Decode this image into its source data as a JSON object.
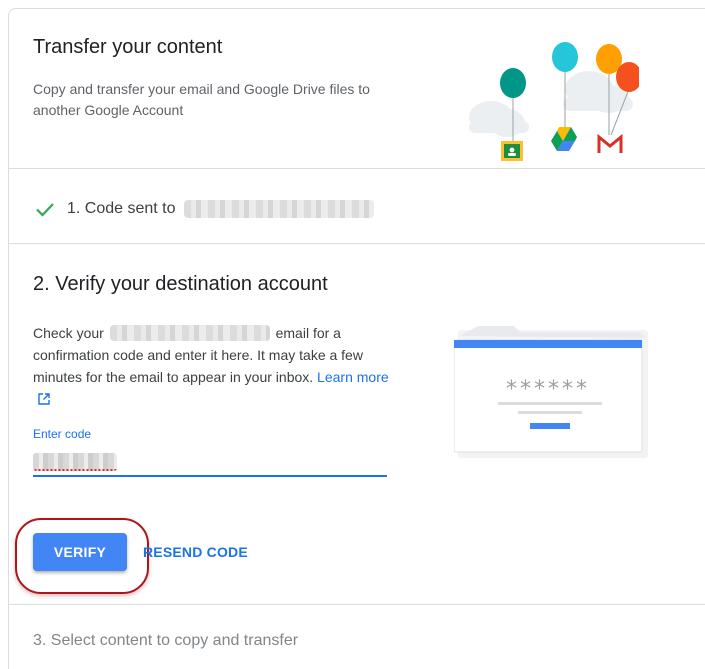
{
  "header": {
    "title": "Transfer your content",
    "description": "Copy and transfer your email and Google Drive files to another Google Account"
  },
  "step1": {
    "label": "1. Code sent to",
    "status": "completed"
  },
  "step2": {
    "title": "2. Verify your destination account",
    "body_before": "Check your",
    "body_after": "email for a confirmation code and enter it here. It may take a few minutes for the email to appear in your inbox.",
    "learn_more": "Learn more",
    "code_field": {
      "label": "Enter code"
    },
    "verify_label": "VERIFY",
    "resend_label": "RESEND CODE",
    "illustration_code": "******"
  },
  "step3": {
    "title": "3. Select content to copy and transfer"
  },
  "colors": {
    "accent": "#1a73e8",
    "button": "#4285f4",
    "check": "#34a853",
    "highlight_ring": "#b0141b",
    "divider": "#dadce0"
  },
  "icons": {
    "check": "check-icon",
    "external": "external-link-icon",
    "classroom": "classroom-icon",
    "drive": "drive-icon",
    "gmail": "gmail-icon"
  }
}
